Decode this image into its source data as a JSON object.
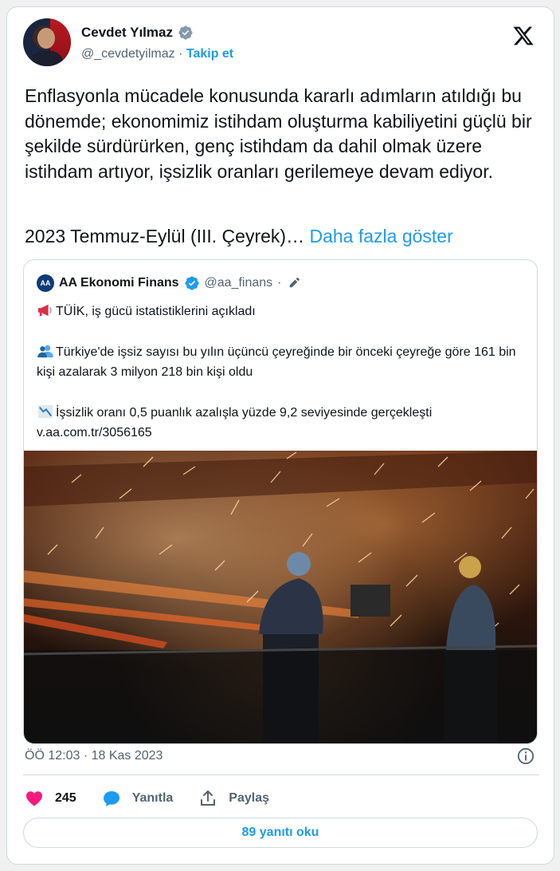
{
  "author": {
    "name": "Cevdet Yılmaz",
    "handle": "@_cevdetyilmaz",
    "separator": "·",
    "follow_label": "Takip et"
  },
  "tweet": {
    "body": "Enflasyonla mücadele konusunda kararlı adımların atıldığı bu dönemde; ekonomimiz istihdam oluşturma kabiliyetini güçlü bir şekilde sürdürürken, genç istihdam da dahil olmak üzere istihdam artıyor, işsizlik oranları gerilemeye devam ediyor.",
    "last_line": "2023 Temmuz-Eylül (III. Çeyrek)…",
    "show_more": "Daha fazla göster"
  },
  "quote": {
    "logo_text": "AA",
    "name": "AA Ekonomi Finans",
    "handle": "@aa_finans",
    "separator": "·",
    "line1": "TÜİK, iş gücü istatistiklerini açıkladı",
    "line2": "Türkiye'de işsiz sayısı bu yılın üçüncü çeyreğinde bir önceki çeyreğe göre 161 bin kişi azalarak 3 milyon 218 bin kişi oldu",
    "line3": "İşsizlik oranı 0,5 puanlık azalışla yüzde 9,2 seviyesinde gerçekleşti",
    "link": "v.aa.com.tr/3056165"
  },
  "footer": {
    "timestamp": "ÖÖ 12:03 · 18 Kas 2023",
    "likes": "245",
    "reply_label": "Yanıtla",
    "share_label": "Paylaş",
    "read_replies": "89 yanıtı oku"
  },
  "colors": {
    "accent": "#1d9bf0",
    "like": "#f91880",
    "muted": "#536471",
    "border": "#cfd9de"
  },
  "icons": [
    "verified-badge-icon",
    "x-logo-icon",
    "edit-icon",
    "megaphone-icon",
    "people-icon",
    "chart-down-icon",
    "info-icon",
    "heart-icon",
    "reply-icon",
    "share-icon"
  ]
}
